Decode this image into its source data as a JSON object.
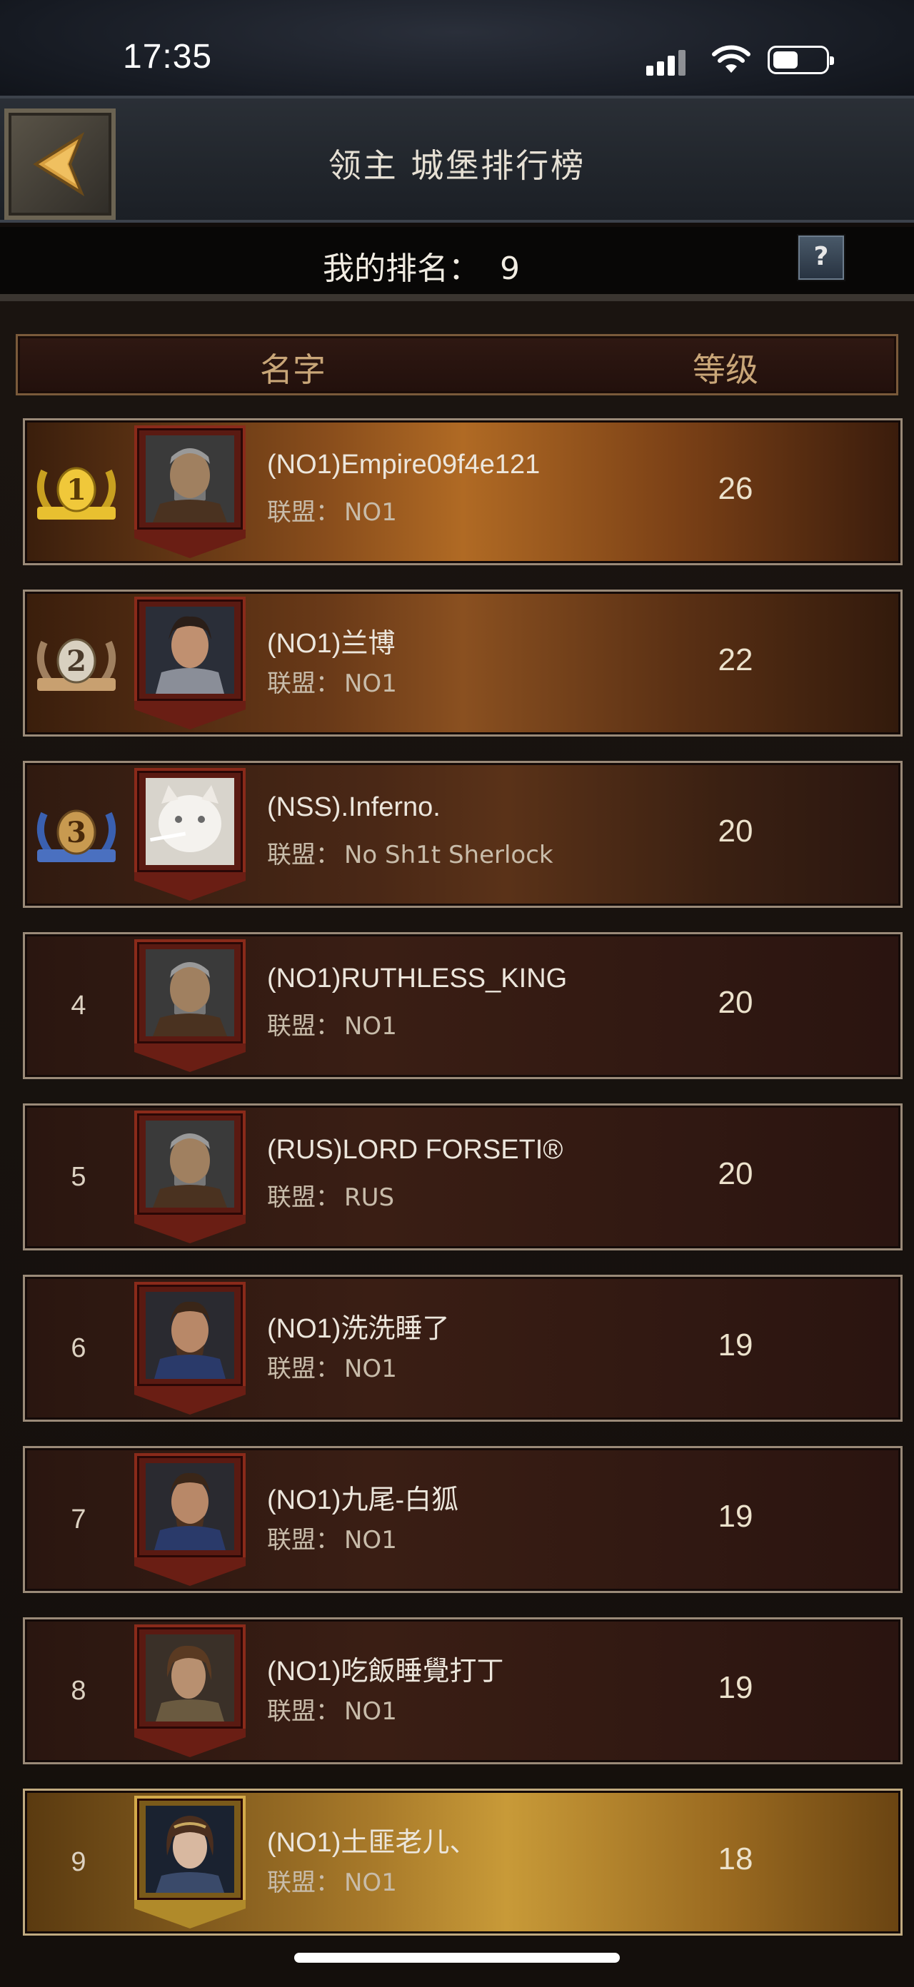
{
  "status_bar": {
    "time": "17:35"
  },
  "header": {
    "title": "领主 城堡排行榜",
    "back_icon": "back-arrow-icon"
  },
  "my_rank": {
    "label": "我的排名：",
    "value": "9",
    "help_label": "?"
  },
  "columns": {
    "name": "名字",
    "level": "等级"
  },
  "alliance_label": "联盟：",
  "rows": [
    {
      "rank": "1",
      "name": "(NO1)Empire09f4e121",
      "alliance": "NO1",
      "level": "26"
    },
    {
      "rank": "2",
      "name": "(NO1)兰博",
      "alliance": "NO1",
      "level": "22"
    },
    {
      "rank": "3",
      "name": "(NSS).Inferno.",
      "alliance": "No Sh1t Sherlock",
      "level": "20"
    },
    {
      "rank": "4",
      "name": "(NO1)RUTHLESS_KING",
      "alliance": "NO1",
      "level": "20"
    },
    {
      "rank": "5",
      "name": "(RUS)LORD FORSETI®",
      "alliance": "RUS",
      "level": "20"
    },
    {
      "rank": "6",
      "name": "(NO1)洗洗睡了",
      "alliance": "NO1",
      "level": "19"
    },
    {
      "rank": "7",
      "name": "(NO1)九尾-白狐",
      "alliance": "NO1",
      "level": "19"
    },
    {
      "rank": "8",
      "name": "(NO1)吃飯睡覺打丁",
      "alliance": "NO1",
      "level": "19"
    },
    {
      "rank": "9",
      "name": "(NO1)土匪老儿、",
      "alliance": "NO1",
      "level": "18"
    }
  ],
  "colors": {
    "gold_row": "#b06a24",
    "my_row": "#c89a38",
    "row_base": "#3a1e14",
    "header_text": "#c9a678"
  }
}
